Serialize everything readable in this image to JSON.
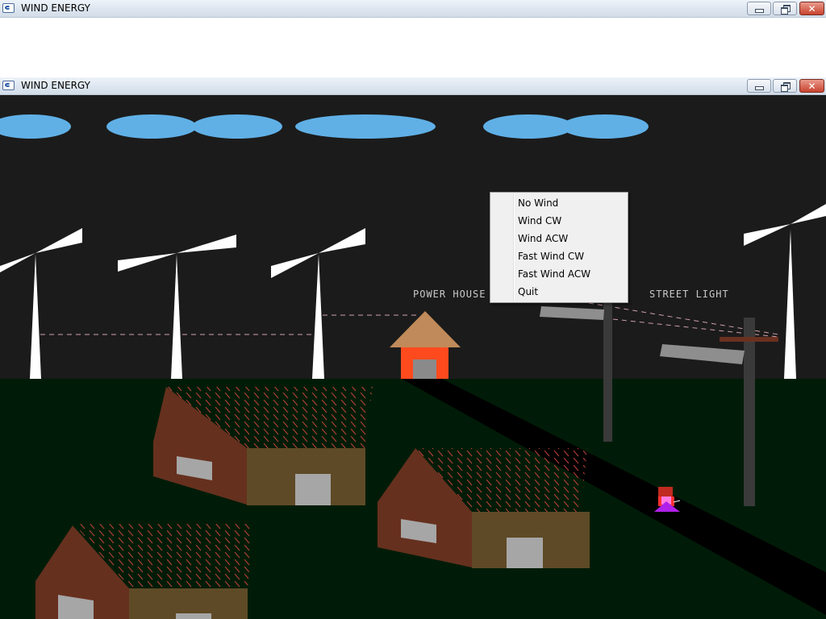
{
  "windows": {
    "back": {
      "title": "WIND ENERGY"
    },
    "front": {
      "title": "WIND ENERGY"
    }
  },
  "window_controls": {
    "minimize": "minimize-icon",
    "maximize": "restore-icon",
    "close": "close-icon"
  },
  "scene": {
    "labels": {
      "power_house": "POWER HOUSE",
      "street_light": "STREET LIGHT"
    },
    "colors": {
      "sky": "#1b1b1b",
      "cloud": "#60b0e6",
      "ground": "#001c08",
      "road": "#000000",
      "turbine": "#ffffff",
      "powerhouse_wall": "#ff4a1e",
      "powerhouse_roof": "#c08a5a",
      "house_wall_side": "#66301e",
      "house_wall_front": "#5e4a26",
      "roof_pattern": "#c04038",
      "window_gray": "#a6a6a6",
      "wire": "#cfa0a8"
    }
  },
  "context_menu": {
    "items": [
      {
        "label": "No Wind"
      },
      {
        "label": "Wind CW"
      },
      {
        "label": "Wind ACW"
      },
      {
        "label": "Fast Wind CW"
      },
      {
        "label": "Fast Wind ACW"
      },
      {
        "label": "Quit"
      }
    ]
  }
}
